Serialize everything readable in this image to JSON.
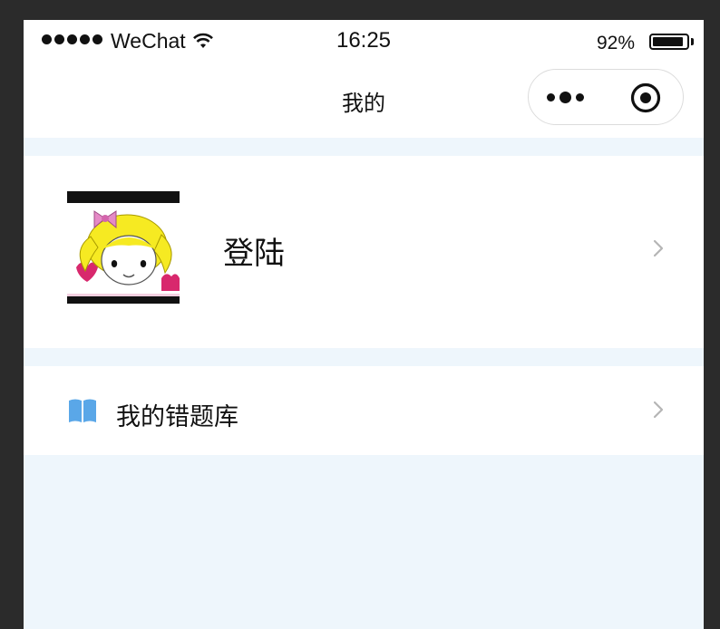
{
  "status_bar": {
    "carrier": "WeChat",
    "time": "16:25",
    "battery_percent": "92%",
    "battery_level": 0.92,
    "icons": [
      "signal-dots-icon",
      "wifi-icon",
      "battery-icon"
    ]
  },
  "nav": {
    "title": "我的",
    "capsule_icons": [
      "more-icon",
      "close-target-icon"
    ]
  },
  "profile": {
    "login_label": "登陆",
    "avatar_icon": "cartoon-girl-avatar",
    "chevron_icon": "chevron-right-icon"
  },
  "menu": {
    "items": [
      {
        "label": "我的错题库",
        "icon": "book-icon",
        "icon_color": "#5aa7e8",
        "chevron_icon": "chevron-right-icon"
      }
    ]
  },
  "colors": {
    "page_background": "#eef6fc",
    "card_background": "#ffffff",
    "outer_frame": "#2b2b2b",
    "chevron": "#b5b5b5"
  }
}
